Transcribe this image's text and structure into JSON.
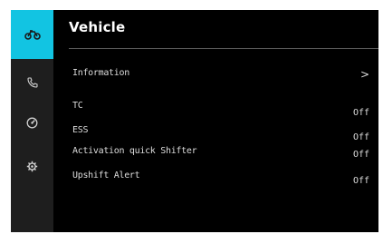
{
  "colors": {
    "sidebar_background": "#1e1e1e",
    "active_accent": "#12c4e2",
    "screen_background": "#000000",
    "text": "#dcdcdc"
  },
  "sidebar": {
    "items": [
      {
        "icon": "motorcycle-icon",
        "active": true
      },
      {
        "icon": "phone-icon",
        "active": false
      },
      {
        "icon": "gauge-icon",
        "active": false
      },
      {
        "icon": "settings-gear-icon",
        "active": false
      }
    ]
  },
  "header": {
    "title": "Vehicle"
  },
  "menu": {
    "information": {
      "label": "Information",
      "chevron": ">"
    },
    "tc": {
      "label": "TC",
      "value": "Off"
    },
    "ess": {
      "label": "ESS",
      "value": "Off"
    },
    "quick_shifter": {
      "label": "Activation quick Shifter",
      "value": "Off"
    },
    "upshift_alert": {
      "label": "Upshift Alert",
      "value": "Off"
    }
  }
}
